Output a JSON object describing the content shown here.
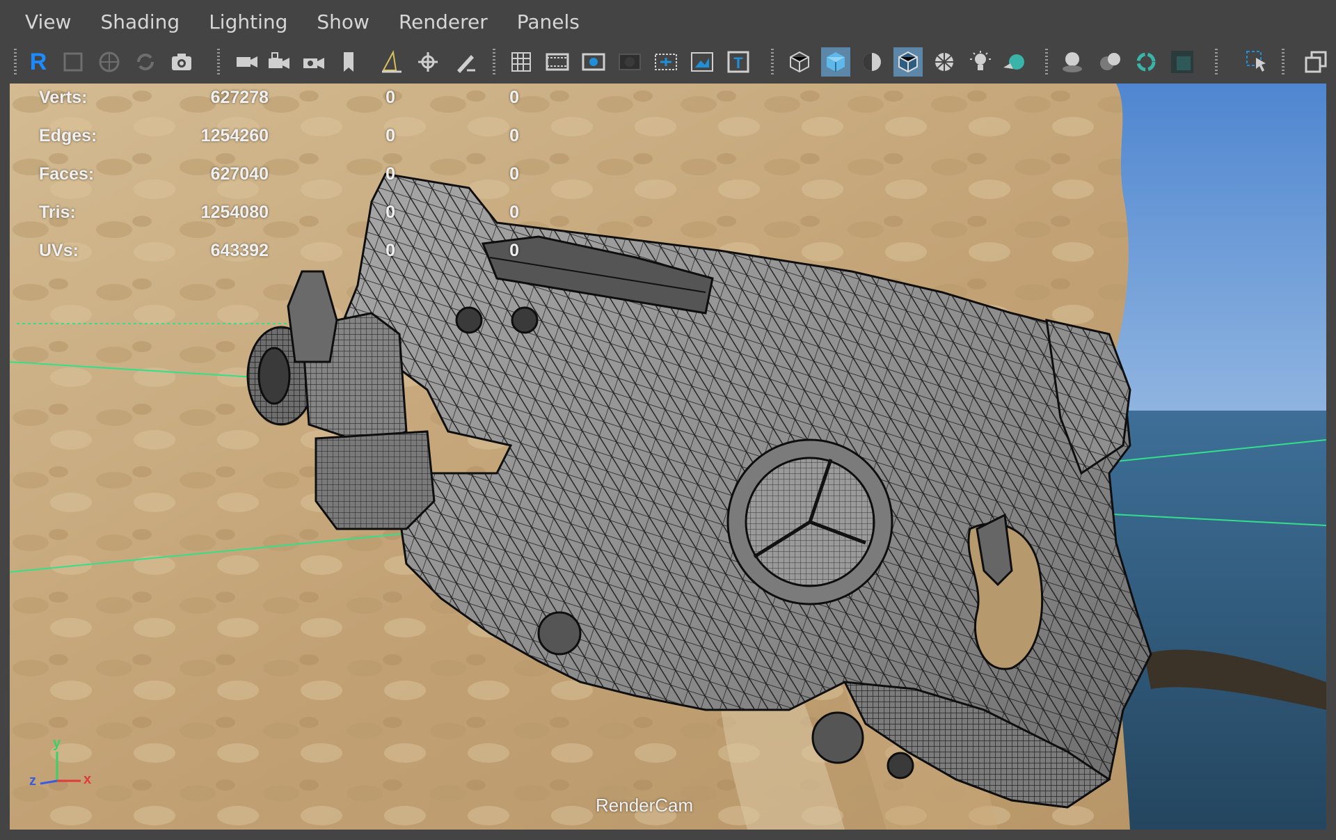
{
  "menu": [
    "View",
    "Shading",
    "Lighting",
    "Show",
    "Renderer",
    "Panels"
  ],
  "toolbar": {
    "icons": [
      "select-camera-icon",
      "lock-camera-icon",
      "bookmark-icon",
      "image-plane-icon",
      "camera-attributes-icon",
      "camera-icon",
      "camera-film-icon",
      "grease-pencil-icon",
      "2d-pan-zoom-icon",
      "grid-icon",
      "film-gate-icon",
      "resolution-gate-icon",
      "gate-mask-icon",
      "field-chart-icon",
      "safe-action-icon",
      "safe-title-icon",
      "wireframe-icon",
      "smooth-shade-icon",
      "default-material-icon",
      "wireframe-on-shaded-icon",
      "xray-icon",
      "lights-icon",
      "shadows-icon",
      "screen-space-ambient-occlusion-icon",
      "motion-blur-icon",
      "anti-aliasing-icon",
      "depth-of-field-icon",
      "isolate-select-icon",
      "xray-joints-icon",
      "panel-layout-icon"
    ],
    "renderer_letter": "R",
    "text_tool_letter": "T",
    "accent": "#5c87a8"
  },
  "hud": {
    "rows": [
      {
        "label": "Verts:",
        "value": "627278",
        "sel": "0",
        "comp": "0"
      },
      {
        "label": "Edges:",
        "value": "1254260",
        "sel": "0",
        "comp": "0"
      },
      {
        "label": "Faces:",
        "value": "627040",
        "sel": "0",
        "comp": "0"
      },
      {
        "label": "Tris:",
        "value": "1254080",
        "sel": "0",
        "comp": "0"
      },
      {
        "label": "UVs:",
        "value": "643392",
        "sel": "0",
        "comp": "0"
      }
    ]
  },
  "viewport": {
    "camera": "RenderCam",
    "axis": {
      "x": "x",
      "y": "y",
      "z": "z"
    },
    "colors": {
      "grid_line": "#33e08a",
      "sea": "#2f5a7d",
      "sky": "#5a8bd0",
      "cliff": "#c9ac80",
      "model": "#8c8c8c",
      "wire": "#111111"
    }
  }
}
